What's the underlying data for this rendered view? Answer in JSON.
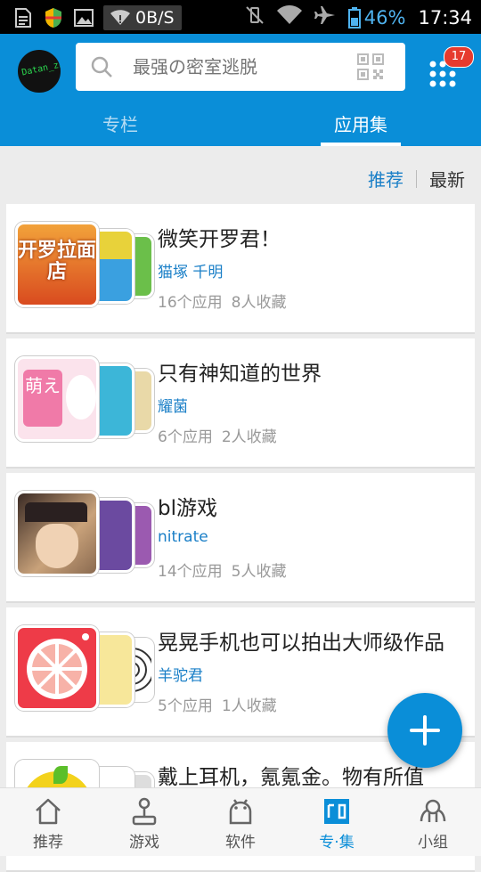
{
  "status_bar": {
    "speed": "0B/S",
    "battery": "46%",
    "time": "17:34"
  },
  "header": {
    "avatar_text": "Datan_zhh",
    "search_placeholder": "最强の密室逃脱",
    "notification_count": "17",
    "tabs": [
      {
        "label": "专栏",
        "active": false
      },
      {
        "label": "应用集",
        "active": true
      }
    ]
  },
  "sort": {
    "recommended": "推荐",
    "newest": "最新"
  },
  "cards": [
    {
      "title": "微笑开罗君！",
      "author": "猫塚 千明",
      "apps": "16个应用",
      "favorites": "8人收藏",
      "icons": {
        "main": "开罗拉面店",
        "mid_color": "#e8d23a",
        "back_color": "#6bbf4a",
        "main_color": "#d94b1f"
      }
    },
    {
      "title": "只有神知道的世界",
      "author": "耀菌",
      "apps": "6个应用",
      "favorites": "2人收藏",
      "icons": {
        "main": "萌え",
        "mid_color": "#3cb6d8",
        "back_color": "#e9d9a8",
        "main_color": "#f07aa8"
      }
    },
    {
      "title": "bl游戏",
      "author": "nitrate",
      "apps": "14个应用",
      "favorites": "5人收藏",
      "icons": {
        "main": "",
        "mid_color": "#6b4aa0",
        "back_color": "#9b5ab0",
        "main_color": "#8a6a50"
      }
    },
    {
      "title": "晃晃手机也可以拍出大师级作品",
      "author": "羊驼君",
      "apps": "5个应用",
      "favorites": "1人收藏",
      "icons": {
        "main": "",
        "mid_color": "#f7e79a",
        "back_color": "#e0e0e0",
        "main_color": "#ee3b48"
      }
    },
    {
      "title": "戴上耳机，氪氪金。物有所值",
      "author": "",
      "apps": "",
      "favorites": "",
      "icons": {
        "main": "",
        "mid_color": "#2a8fe0",
        "back_color": "#dddddd",
        "main_color": "#f3d21c"
      }
    }
  ],
  "bottom_nav": [
    {
      "label": "推荐",
      "active": false
    },
    {
      "label": "游戏",
      "active": false
    },
    {
      "label": "软件",
      "active": false
    },
    {
      "label": "专·集",
      "active": true
    },
    {
      "label": "小组",
      "active": false
    }
  ],
  "colors": {
    "brand": "#0a8ed8",
    "link": "#1a7fc7",
    "badge": "#e63a2e"
  }
}
